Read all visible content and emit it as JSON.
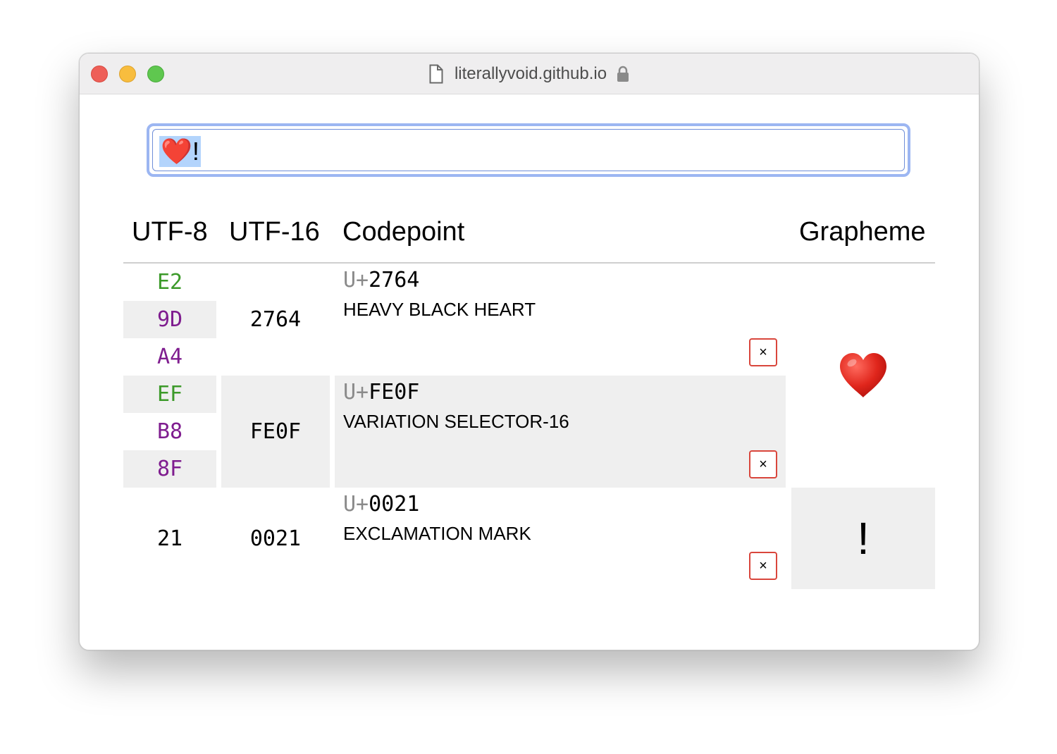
{
  "window": {
    "address": "literallyvoid.github.io"
  },
  "input": {
    "value": "❤️!"
  },
  "table": {
    "headers": {
      "utf8": "UTF-8",
      "utf16": "UTF-16",
      "codepoint": "Codepoint",
      "grapheme": "Grapheme"
    },
    "utf8_bytes": [
      "E2",
      "9D",
      "A4",
      "EF",
      "B8",
      "8F",
      "21"
    ],
    "utf16_units": [
      "2764",
      "FE0F",
      "0021"
    ],
    "codepoints": [
      {
        "prefix": "U+",
        "hex": "2764",
        "name": "HEAVY BLACK HEART",
        "delete": "×"
      },
      {
        "prefix": "U+",
        "hex": "FE0F",
        "name": "VARIATION SELECTOR-16",
        "delete": "×"
      },
      {
        "prefix": "U+",
        "hex": "0021",
        "name": "EXCLAMATION MARK",
        "delete": "×"
      }
    ],
    "graphemes": [
      "❤️",
      "!"
    ]
  },
  "colors": {
    "lead_byte": "#3c9a2a",
    "continuation_byte": "#7f1d8f",
    "focus_ring": "#9cb6f2",
    "delete_border": "#d9463c"
  }
}
